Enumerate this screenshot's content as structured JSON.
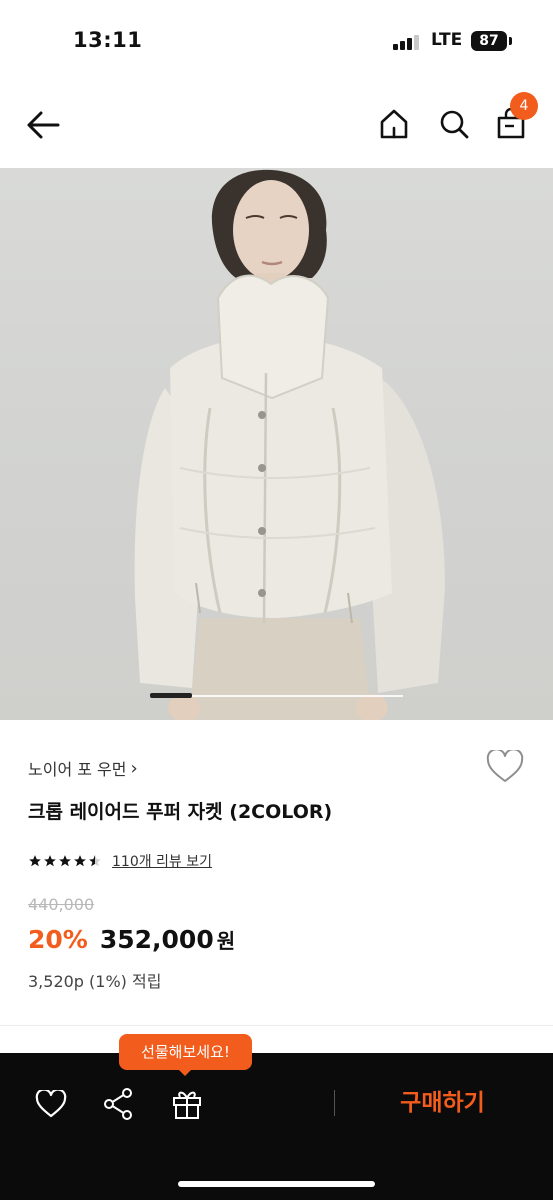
{
  "status_bar": {
    "time": "13:11",
    "network": "LTE",
    "battery": "87"
  },
  "nav": {
    "back_icon": "arrow-left-icon",
    "home_icon": "home-icon",
    "search_icon": "search-icon",
    "cart_icon": "shopping-bag-icon",
    "cart_count": "4"
  },
  "product": {
    "brand": "노이어 포 우먼",
    "brand_chevron": "›",
    "title": "크롭 레이어드 푸퍼 자켓 (2COLOR)",
    "rating": 4.5,
    "review_link": "110개 리뷰 보기",
    "original_price": "440,000",
    "discount": "20%",
    "price": "352,000",
    "price_unit": "원",
    "points": "3,520p (1%) 적립"
  },
  "bottom_bar": {
    "gift_tooltip": "선물해보세요!",
    "buy_label": "구매하기",
    "wish_icon": "heart-icon",
    "share_icon": "share-icon",
    "gift_icon": "gift-icon"
  },
  "colors": {
    "accent": "#f25c1c",
    "bottom_bar_bg": "#0b0b0b",
    "text": "#111111"
  }
}
